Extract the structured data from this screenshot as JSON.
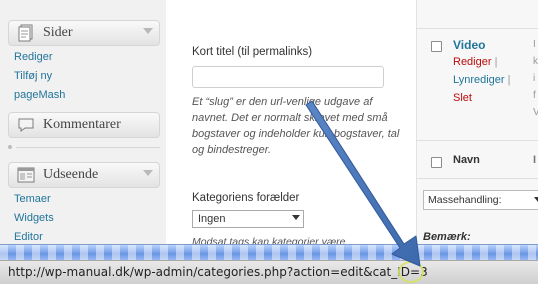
{
  "sidebar": {
    "pages_menu": {
      "label": "Sider",
      "items": [
        {
          "label": "Rediger"
        },
        {
          "label": "Tilføj ny"
        },
        {
          "label": "pageMash"
        }
      ]
    },
    "comments_menu": {
      "label": "Kommentarer"
    },
    "appearance_menu": {
      "label": "Udseende",
      "items": [
        {
          "label": "Temaer"
        },
        {
          "label": "Widgets"
        },
        {
          "label": "Editor"
        }
      ]
    }
  },
  "form": {
    "slug_label": "Kort titel (til permalinks)",
    "slug_value": "",
    "slug_help": "Et “slug” er den url-venlige udgave af navnet. Det er normalt skrevet med små bogstaver og indeholder kun bogstaver, tal og bindestreger.",
    "parent_label": "Kategoriens forælder",
    "parent_value": "Ingen",
    "parent_help": "Modsat tags kan kategorier være"
  },
  "list": {
    "row_title": "Video",
    "actions": {
      "edit": "Rediger",
      "quick_edit": "Lynrediger",
      "delete": "Slet",
      "separator": "|"
    },
    "desc_fragments": [
      "I",
      "k",
      "i",
      "f",
      "V"
    ],
    "column_name": "Navn",
    "bulk_actions": "Massehandling:",
    "note": "Bemærk:"
  },
  "status_bar": {
    "url": "http://wp-manual.dk/wp-admin/categories.php?action=edit&cat_ID=3"
  },
  "colors": {
    "link": "#21759b",
    "delete": "#bc0b0b",
    "pointer_arrow": "#4a78b8",
    "progress": "#6c96e4"
  },
  "icons": [
    "pages-icon",
    "comments-icon",
    "appearance-icon",
    "pointer-arrow"
  ]
}
